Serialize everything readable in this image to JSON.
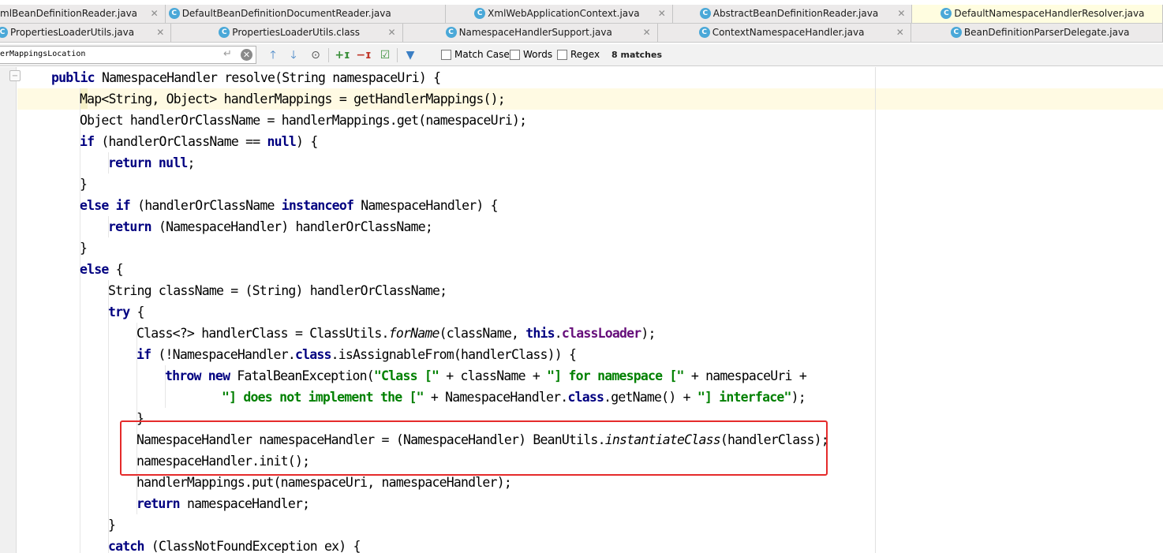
{
  "tabs_row1": [
    {
      "label": "mlBeanDefinitionReader.java",
      "icon": "",
      "active": false
    },
    {
      "label": "DefaultBeanDefinitionDocumentReader.java",
      "icon": "class-icon",
      "active": false
    },
    {
      "label": "XmlWebApplicationContext.java",
      "icon": "class-icon",
      "active": false
    },
    {
      "label": "AbstractBeanDefinitionReader.java",
      "icon": "class-icon",
      "active": false
    },
    {
      "label": "DefaultNamespaceHandlerResolver.java",
      "icon": "class-icon",
      "active": true
    }
  ],
  "tabs_row2": [
    {
      "label": "PropertiesLoaderUtils.java",
      "icon": "class-icon",
      "active": false
    },
    {
      "label": "PropertiesLoaderUtils.class",
      "icon": "class-icon",
      "active": false
    },
    {
      "label": "NamespaceHandlerSupport.java",
      "icon": "class-icon",
      "active": false
    },
    {
      "label": "ContextNamespaceHandler.java",
      "icon": "class-icon",
      "active": false
    },
    {
      "label": "BeanDefinitionParserDelegate.java",
      "icon": "class-icon",
      "active": false
    }
  ],
  "find": {
    "query": "erMappingsLocation",
    "match_case_label": "Match Case",
    "words_label": "Words",
    "regex_label": "Regex",
    "matches": "8 matches",
    "match_case_checked": false,
    "words_checked": false,
    "regex_checked": false
  },
  "code": [
    [
      {
        "t": "public",
        "c": "kw"
      },
      {
        "t": " NamespaceHandler resolve(String namespaceUri) {"
      }
    ],
    [
      {
        "t": "Map<String, Object> handlerMappings = getHandlerMappings();"
      }
    ],
    [
      {
        "t": "Object handlerOrClassName = handlerMappings.get(namespaceUri);"
      }
    ],
    [
      {
        "t": "if",
        "c": "kw"
      },
      {
        "t": " (handlerOrClassName == "
      },
      {
        "t": "null",
        "c": "kw"
      },
      {
        "t": ") {"
      }
    ],
    [
      {
        "t": "return null",
        "c": "kw"
      },
      {
        "t": ";"
      }
    ],
    [
      {
        "t": "}"
      }
    ],
    [
      {
        "t": "else if",
        "c": "kw"
      },
      {
        "t": " (handlerOrClassName "
      },
      {
        "t": "instanceof",
        "c": "kw"
      },
      {
        "t": " NamespaceHandler) {"
      }
    ],
    [
      {
        "t": "return",
        "c": "kw"
      },
      {
        "t": " (NamespaceHandler) handlerOrClassName;"
      }
    ],
    [
      {
        "t": "}"
      }
    ],
    [
      {
        "t": "else",
        "c": "kw"
      },
      {
        "t": " {"
      }
    ],
    [
      {
        "t": "String className = (String) handlerOrClassName;"
      }
    ],
    [
      {
        "t": "try",
        "c": "kw"
      },
      {
        "t": " {"
      }
    ],
    [
      {
        "t": "Class<?> handlerClass = ClassUtils."
      },
      {
        "t": "forName",
        "c": "ital"
      },
      {
        "t": "(className, "
      },
      {
        "t": "this",
        "c": "kw"
      },
      {
        "t": "."
      },
      {
        "t": "classLoader",
        "c": "fld"
      },
      {
        "t": ");"
      }
    ],
    [
      {
        "t": "if",
        "c": "kw"
      },
      {
        "t": " (!NamespaceHandler."
      },
      {
        "t": "class",
        "c": "kw"
      },
      {
        "t": ".isAssignableFrom(handlerClass)) {"
      }
    ],
    [
      {
        "t": "throw new",
        "c": "kw"
      },
      {
        "t": " FatalBeanException("
      },
      {
        "t": "\"Class [\"",
        "c": "str"
      },
      {
        "t": " + className + "
      },
      {
        "t": "\"] for namespace [\"",
        "c": "str"
      },
      {
        "t": " + namespaceUri +"
      }
    ],
    [
      {
        "t": "\"] does not implement the [\"",
        "c": "str"
      },
      {
        "t": " + NamespaceHandler."
      },
      {
        "t": "class",
        "c": "kw"
      },
      {
        "t": ".getName() + "
      },
      {
        "t": "\"] interface\"",
        "c": "str"
      },
      {
        "t": ");"
      }
    ],
    [
      {
        "t": "}"
      }
    ],
    [
      {
        "t": "NamespaceHandler namespaceHandler = (NamespaceHandler) BeanUtils."
      },
      {
        "t": "instantiateClass",
        "c": "ital"
      },
      {
        "t": "(handlerClass);"
      }
    ],
    [
      {
        "t": "namespaceHandler.init();"
      }
    ],
    [
      {
        "t": "handlerMappings.put(namespaceUri, namespaceHandler);"
      }
    ],
    [
      {
        "t": "return",
        "c": "kw"
      },
      {
        "t": " namespaceHandler;"
      }
    ],
    [
      {
        "t": "}"
      }
    ],
    [
      {
        "t": "catch",
        "c": "kw"
      },
      {
        "t": " (ClassNotFoundException ex) {"
      }
    ]
  ]
}
